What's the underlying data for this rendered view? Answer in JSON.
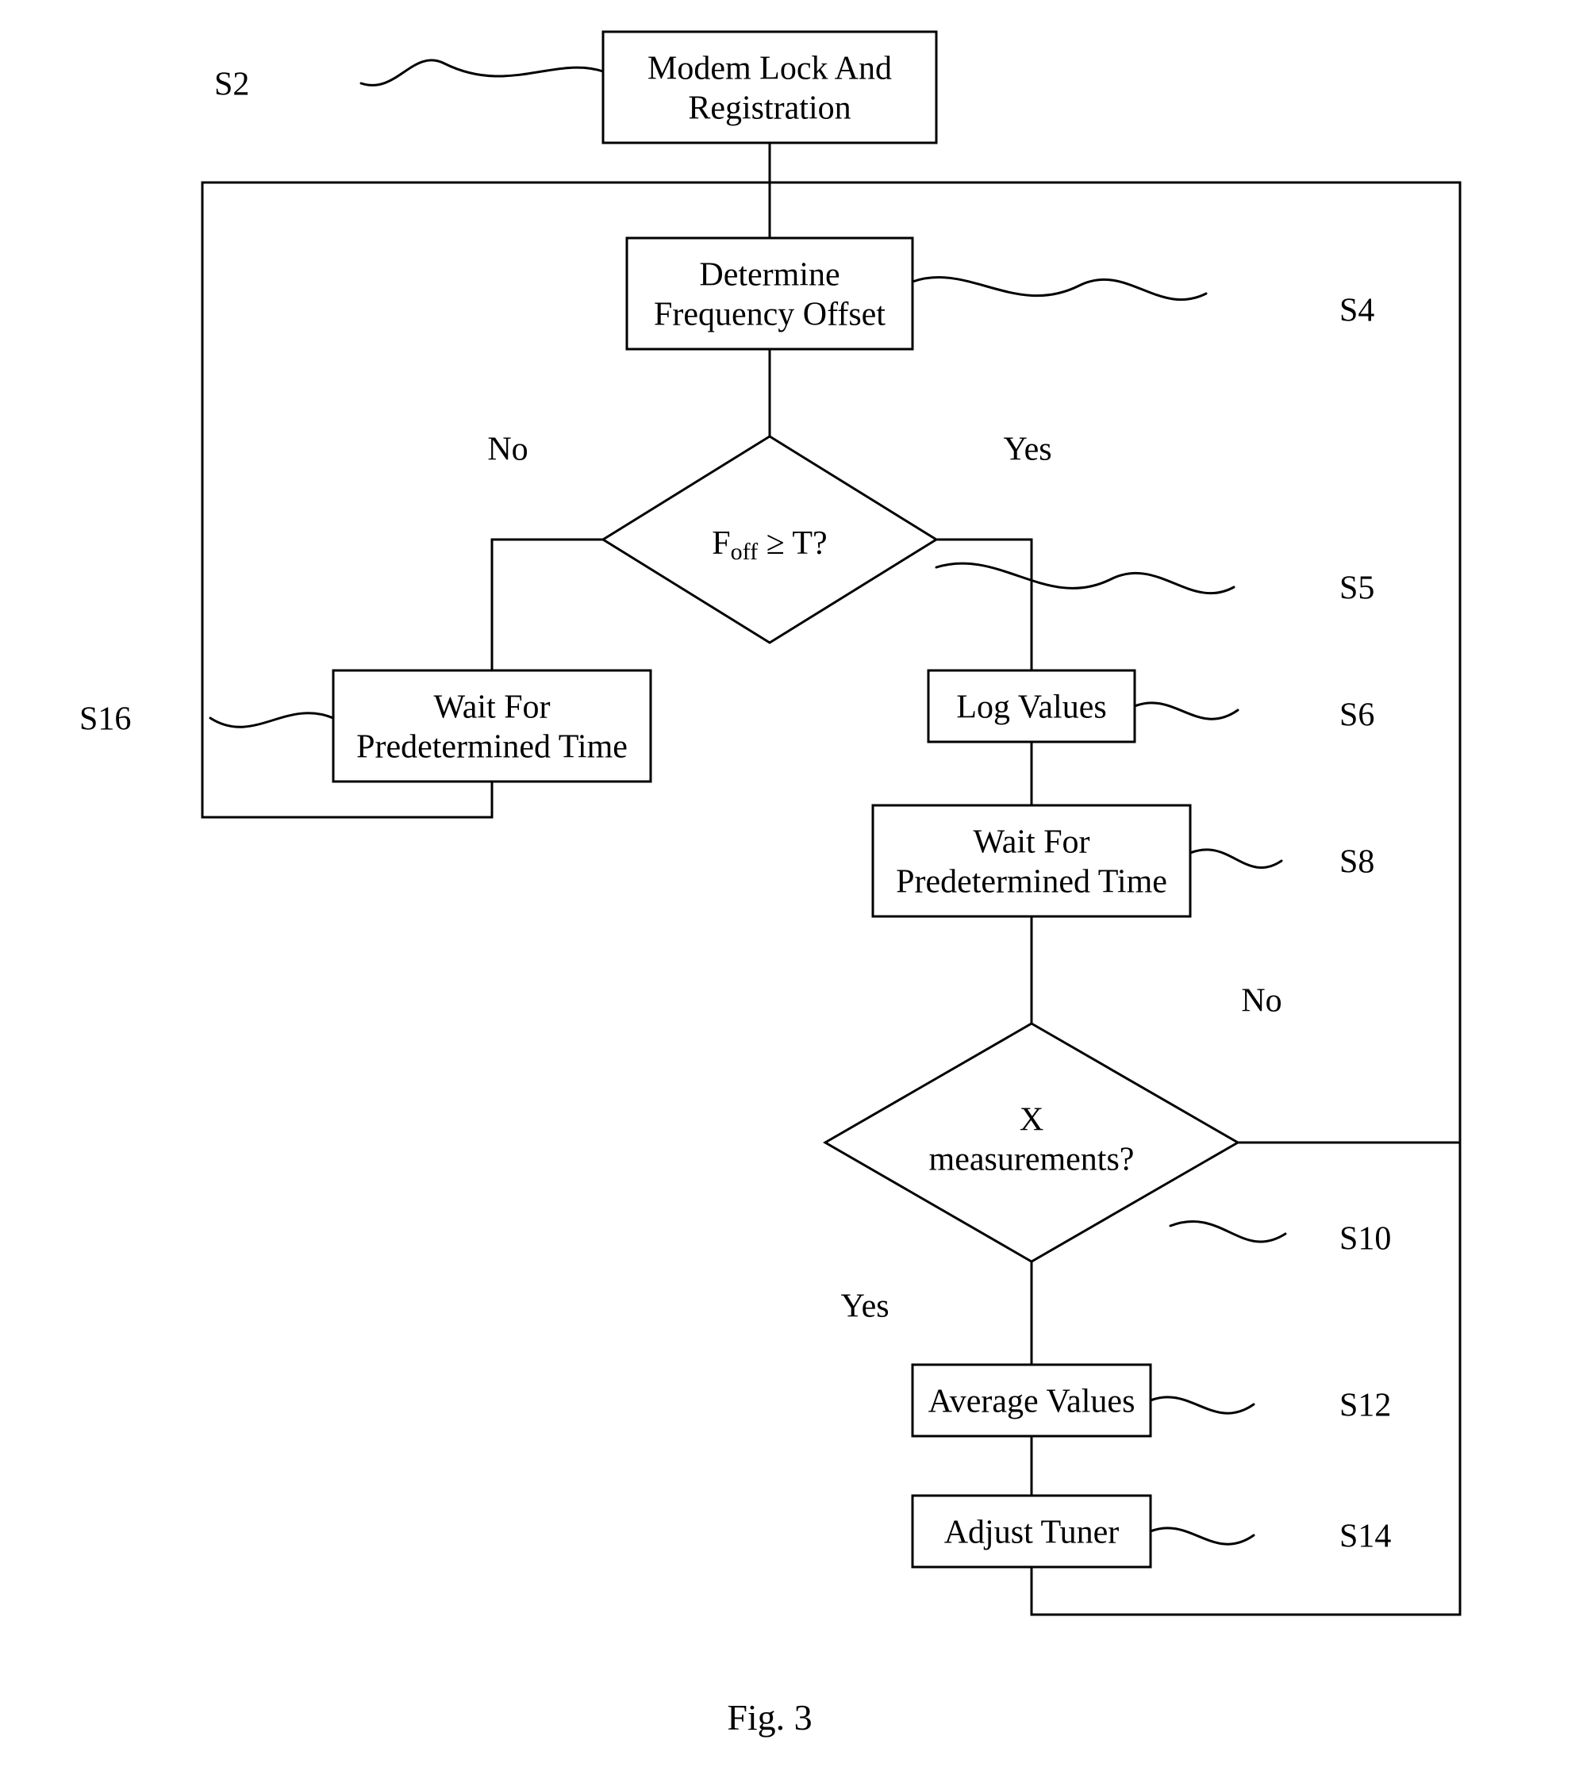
{
  "figure_label": "Fig. 3",
  "boxes": {
    "s2": "Modem Lock And\nRegistration",
    "s4": "Determine\nFrequency Offset",
    "s6": "Log Values",
    "s8": "Wait For\nPredetermined Time",
    "s12": "Average Values",
    "s14": "Adjust Tuner",
    "s16": "Wait For\nPredetermined Time"
  },
  "decisions": {
    "s5": "Foff  ≥  T?",
    "s10": "X\nmeasurements?"
  },
  "branch": {
    "yes": "Yes",
    "no": "No"
  },
  "callouts": {
    "s2": "S2",
    "s4": "S4",
    "s5": "S5",
    "s6": "S6",
    "s8": "S8",
    "s10": "S10",
    "s12": "S12",
    "s14": "S14",
    "s16": "S16"
  }
}
